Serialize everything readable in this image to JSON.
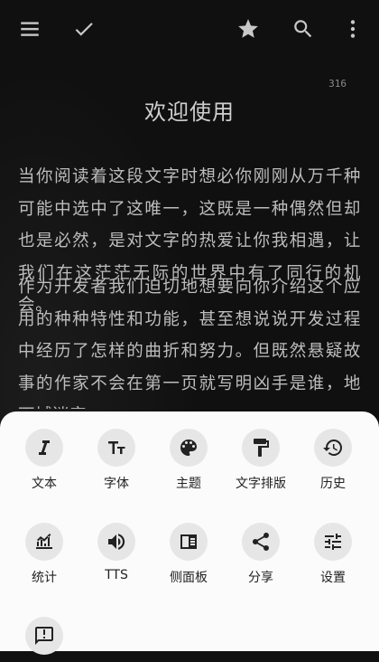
{
  "toolbar": {
    "left": [
      {
        "icon": "menu-icon"
      },
      {
        "icon": "check-icon"
      }
    ],
    "right": [
      {
        "icon": "star-icon"
      },
      {
        "icon": "search-icon"
      },
      {
        "icon": "more-vert-icon"
      }
    ]
  },
  "reader": {
    "counter": "316",
    "title": "欢迎使用",
    "paragraphs": [
      "当你阅读着这段文字时想必你刚刚从万千种可能中选中了这唯一，这既是一种偶然但却也是必然，是对文字的热爱让你我相遇，让我们在这茫茫无际的世界中有了同行的机会。",
      "作为开发者我们迫切地想要向你介绍这个应用的种种特性和功能，甚至想说说开发过程中经历了怎样的曲折和努力。但既然悬疑故事的作家不会在第一页就写明凶手是谁，地下城迷宫"
    ]
  },
  "menu": {
    "items": [
      {
        "label": "文本",
        "icon": "text-italic-icon"
      },
      {
        "label": "字体",
        "icon": "font-size-icon"
      },
      {
        "label": "主题",
        "icon": "palette-icon"
      },
      {
        "label": "文字排版",
        "icon": "format-paint-icon"
      },
      {
        "label": "历史",
        "icon": "history-icon"
      },
      {
        "label": "统计",
        "icon": "statistics-icon"
      },
      {
        "label": "TTS",
        "icon": "speaker-icon"
      },
      {
        "label": "侧面板",
        "icon": "side-panel-icon"
      },
      {
        "label": "分享",
        "icon": "share-icon"
      },
      {
        "label": "设置",
        "icon": "settings-sliders-icon"
      },
      {
        "label": "",
        "icon": "feedback-icon"
      }
    ]
  }
}
